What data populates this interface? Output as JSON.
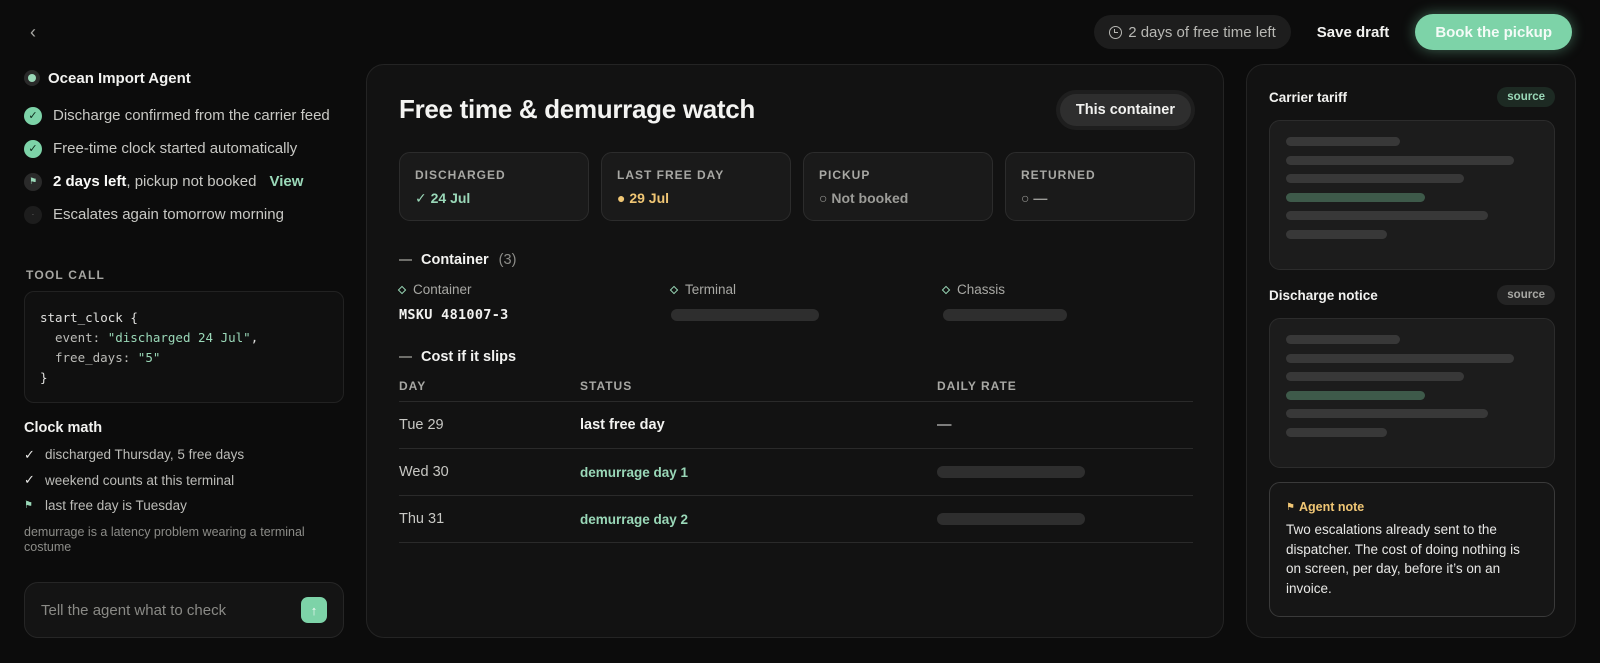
{
  "topbar": {
    "back_icon": "chevron-left-icon",
    "free_time_pill": "2 days of free time left",
    "save_draft": "Save draft",
    "book_pickup": "Book the pickup",
    "accent": "#7dd3a8"
  },
  "agent": {
    "name": "Ocean Import Agent",
    "steps": [
      {
        "text": "Discharge confirmed from the carrier feed",
        "state": "done"
      },
      {
        "text": "Free-time clock started automatically",
        "state": "done"
      },
      {
        "bold": "2 days left",
        "text": ", pickup not booked",
        "link": "View",
        "state": "flag"
      },
      {
        "text": "Escalates again tomorrow morning",
        "state": "pending"
      }
    ]
  },
  "tool_call": {
    "label": "TOOL CALL",
    "fn": "start_clock",
    "open": "{",
    "event_key": "event:",
    "event_val": "\"discharged 24 Jul\"",
    "event_comma": ",",
    "free_key": "free_days:",
    "free_val": "\"5\"",
    "close": "}"
  },
  "clock_math": {
    "title": "Clock math",
    "items": [
      {
        "icon": "check",
        "text": "discharged Thursday, 5 free days"
      },
      {
        "icon": "check",
        "text": "weekend counts at this terminal"
      },
      {
        "icon": "flag",
        "text": "last free day is Tuesday"
      }
    ],
    "note": "demurrage is a latency problem wearing a terminal costume"
  },
  "ask": {
    "placeholder": "Tell the agent what to check"
  },
  "main": {
    "title": "Free time & demurrage watch",
    "scope_button": "This container",
    "stats": [
      {
        "label": "DISCHARGED",
        "value": "✓ 24 Jul",
        "tone": "green"
      },
      {
        "label": "LAST FREE DAY",
        "value": "● 29 Jul",
        "tone": "amber"
      },
      {
        "label": "PICKUP",
        "value": "○ Not booked",
        "tone": "muted"
      },
      {
        "label": "RETURNED",
        "value": "○ —",
        "tone": "muted"
      }
    ],
    "container_section": {
      "title": "Container",
      "count": "(3)",
      "fields": [
        {
          "label": "Container",
          "value": "MSKU 481007-3"
        },
        {
          "label": "Terminal",
          "value": null
        },
        {
          "label": "Chassis",
          "value": null
        }
      ]
    },
    "cost_section": {
      "title": "Cost if it slips",
      "columns": [
        "DAY",
        "STATUS",
        "DAILY RATE"
      ],
      "rows": [
        {
          "day": "Tue 29",
          "status": "last free day",
          "status_tone": "plain",
          "rate": "—"
        },
        {
          "day": "Wed 30",
          "status": "demurrage day 1",
          "status_tone": "green",
          "rate": null
        },
        {
          "day": "Thu 31",
          "status": "demurrage day 2",
          "status_tone": "green",
          "rate": null
        }
      ]
    }
  },
  "sources": {
    "tariff": {
      "title": "Carrier tariff",
      "badge": "source"
    },
    "discharge": {
      "title": "Discharge notice",
      "badge": "source"
    },
    "note": {
      "title": "Agent note",
      "body": "Two escalations already sent to the dispatcher. The cost of doing nothing is on screen, per day, before it’s on an invoice."
    }
  }
}
